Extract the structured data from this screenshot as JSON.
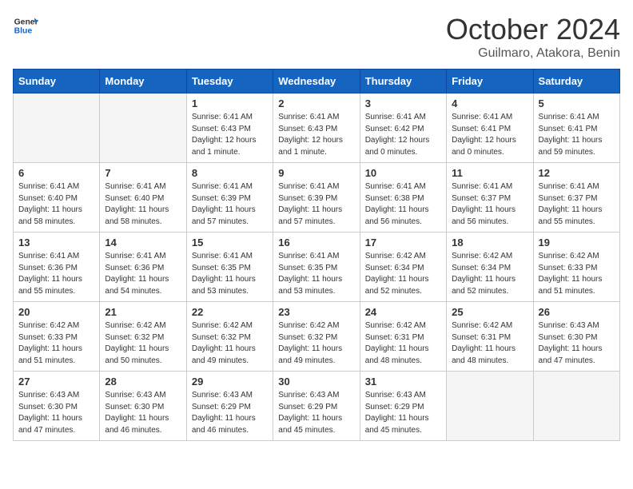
{
  "header": {
    "logo_general": "General",
    "logo_blue": "Blue",
    "month_title": "October 2024",
    "location": "Guilmaro, Atakora, Benin"
  },
  "days_of_week": [
    "Sunday",
    "Monday",
    "Tuesday",
    "Wednesday",
    "Thursday",
    "Friday",
    "Saturday"
  ],
  "weeks": [
    [
      {
        "day": "",
        "info": ""
      },
      {
        "day": "",
        "info": ""
      },
      {
        "day": "1",
        "info": "Sunrise: 6:41 AM\nSunset: 6:43 PM\nDaylight: 12 hours and 1 minute."
      },
      {
        "day": "2",
        "info": "Sunrise: 6:41 AM\nSunset: 6:43 PM\nDaylight: 12 hours and 1 minute."
      },
      {
        "day": "3",
        "info": "Sunrise: 6:41 AM\nSunset: 6:42 PM\nDaylight: 12 hours and 0 minutes."
      },
      {
        "day": "4",
        "info": "Sunrise: 6:41 AM\nSunset: 6:41 PM\nDaylight: 12 hours and 0 minutes."
      },
      {
        "day": "5",
        "info": "Sunrise: 6:41 AM\nSunset: 6:41 PM\nDaylight: 11 hours and 59 minutes."
      }
    ],
    [
      {
        "day": "6",
        "info": "Sunrise: 6:41 AM\nSunset: 6:40 PM\nDaylight: 11 hours and 58 minutes."
      },
      {
        "day": "7",
        "info": "Sunrise: 6:41 AM\nSunset: 6:40 PM\nDaylight: 11 hours and 58 minutes."
      },
      {
        "day": "8",
        "info": "Sunrise: 6:41 AM\nSunset: 6:39 PM\nDaylight: 11 hours and 57 minutes."
      },
      {
        "day": "9",
        "info": "Sunrise: 6:41 AM\nSunset: 6:39 PM\nDaylight: 11 hours and 57 minutes."
      },
      {
        "day": "10",
        "info": "Sunrise: 6:41 AM\nSunset: 6:38 PM\nDaylight: 11 hours and 56 minutes."
      },
      {
        "day": "11",
        "info": "Sunrise: 6:41 AM\nSunset: 6:37 PM\nDaylight: 11 hours and 56 minutes."
      },
      {
        "day": "12",
        "info": "Sunrise: 6:41 AM\nSunset: 6:37 PM\nDaylight: 11 hours and 55 minutes."
      }
    ],
    [
      {
        "day": "13",
        "info": "Sunrise: 6:41 AM\nSunset: 6:36 PM\nDaylight: 11 hours and 55 minutes."
      },
      {
        "day": "14",
        "info": "Sunrise: 6:41 AM\nSunset: 6:36 PM\nDaylight: 11 hours and 54 minutes."
      },
      {
        "day": "15",
        "info": "Sunrise: 6:41 AM\nSunset: 6:35 PM\nDaylight: 11 hours and 53 minutes."
      },
      {
        "day": "16",
        "info": "Sunrise: 6:41 AM\nSunset: 6:35 PM\nDaylight: 11 hours and 53 minutes."
      },
      {
        "day": "17",
        "info": "Sunrise: 6:42 AM\nSunset: 6:34 PM\nDaylight: 11 hours and 52 minutes."
      },
      {
        "day": "18",
        "info": "Sunrise: 6:42 AM\nSunset: 6:34 PM\nDaylight: 11 hours and 52 minutes."
      },
      {
        "day": "19",
        "info": "Sunrise: 6:42 AM\nSunset: 6:33 PM\nDaylight: 11 hours and 51 minutes."
      }
    ],
    [
      {
        "day": "20",
        "info": "Sunrise: 6:42 AM\nSunset: 6:33 PM\nDaylight: 11 hours and 51 minutes."
      },
      {
        "day": "21",
        "info": "Sunrise: 6:42 AM\nSunset: 6:32 PM\nDaylight: 11 hours and 50 minutes."
      },
      {
        "day": "22",
        "info": "Sunrise: 6:42 AM\nSunset: 6:32 PM\nDaylight: 11 hours and 49 minutes."
      },
      {
        "day": "23",
        "info": "Sunrise: 6:42 AM\nSunset: 6:32 PM\nDaylight: 11 hours and 49 minutes."
      },
      {
        "day": "24",
        "info": "Sunrise: 6:42 AM\nSunset: 6:31 PM\nDaylight: 11 hours and 48 minutes."
      },
      {
        "day": "25",
        "info": "Sunrise: 6:42 AM\nSunset: 6:31 PM\nDaylight: 11 hours and 48 minutes."
      },
      {
        "day": "26",
        "info": "Sunrise: 6:43 AM\nSunset: 6:30 PM\nDaylight: 11 hours and 47 minutes."
      }
    ],
    [
      {
        "day": "27",
        "info": "Sunrise: 6:43 AM\nSunset: 6:30 PM\nDaylight: 11 hours and 47 minutes."
      },
      {
        "day": "28",
        "info": "Sunrise: 6:43 AM\nSunset: 6:30 PM\nDaylight: 11 hours and 46 minutes."
      },
      {
        "day": "29",
        "info": "Sunrise: 6:43 AM\nSunset: 6:29 PM\nDaylight: 11 hours and 46 minutes."
      },
      {
        "day": "30",
        "info": "Sunrise: 6:43 AM\nSunset: 6:29 PM\nDaylight: 11 hours and 45 minutes."
      },
      {
        "day": "31",
        "info": "Sunrise: 6:43 AM\nSunset: 6:29 PM\nDaylight: 11 hours and 45 minutes."
      },
      {
        "day": "",
        "info": ""
      },
      {
        "day": "",
        "info": ""
      }
    ]
  ]
}
